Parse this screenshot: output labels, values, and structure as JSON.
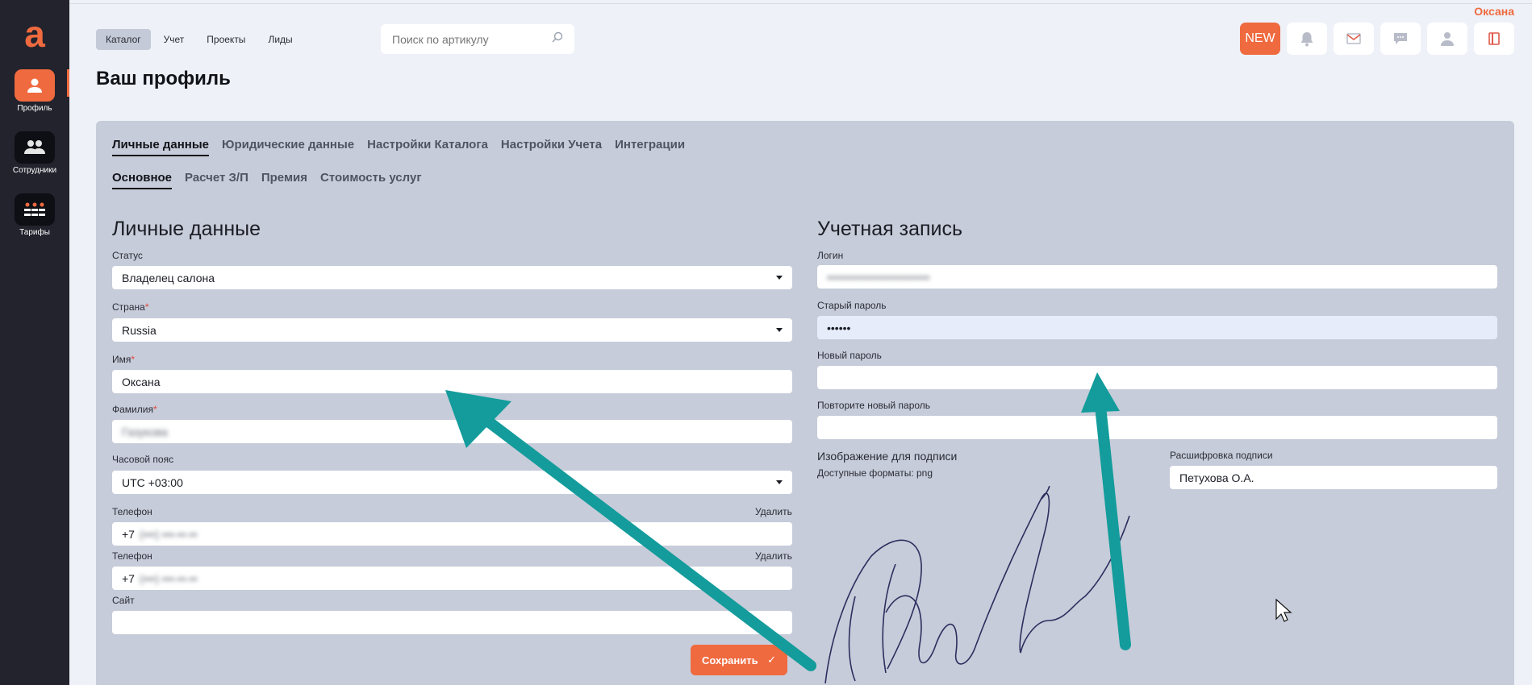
{
  "user": {
    "name": "Оксана"
  },
  "sidebar": {
    "items": [
      {
        "label": "Профиль",
        "icon": "user-icon",
        "active": true
      },
      {
        "label": "Сотрудники",
        "icon": "users-icon",
        "active": false
      },
      {
        "label": "Тарифы",
        "icon": "grid-icon",
        "active": false
      }
    ]
  },
  "nav": {
    "items": [
      "Каталог",
      "Учет",
      "Проекты",
      "Лиды"
    ],
    "active": "Каталог"
  },
  "search": {
    "placeholder": "Поиск по артикулу"
  },
  "top_buttons": {
    "new_label": "NEW"
  },
  "page": {
    "title": "Ваш профиль"
  },
  "tabs": [
    "Личные данные",
    "Юридические данные",
    "Настройки Каталога",
    "Настройки Учета",
    "Интеграции"
  ],
  "subtabs": [
    "Основное",
    "Расчет З/П",
    "Премия",
    "Стоимость услуг"
  ],
  "personal": {
    "title": "Личные данные",
    "status_label": "Статус",
    "status_value": "Владелец салона",
    "country_label": "Страна",
    "country_value": "Russia",
    "first_name_label": "Имя",
    "first_name_value": "Оксана",
    "last_name_label": "Фамилия",
    "last_name_value": "Газукова",
    "timezone_label": "Часовой пояс",
    "timezone_value": "UTC +03:00",
    "phone_label": "Телефон",
    "delete_label": "Удалить",
    "phone1_value": "+7",
    "phone2_value": "+7",
    "site_label": "Сайт",
    "site_value": "",
    "save_label": "Сохранить"
  },
  "account": {
    "title": "Учетная запись",
    "login_label": "Логин",
    "old_password_label": "Старый пароль",
    "old_password_value": "••••••",
    "new_password_label": "Новый пароль",
    "repeat_password_label": "Повторите новый пароль",
    "signature_title": "Изображение для подписи",
    "signature_formats": "Доступные форматы: png",
    "signature_decode_label": "Расшифровка подписи",
    "signature_decode_value": "Петухова О.А."
  },
  "colors": {
    "accent": "#ef6a3f",
    "sidebar": "#22232d",
    "panel": "#c7ccda",
    "arrow": "#139c9b",
    "signature": "#2b2f5e"
  }
}
